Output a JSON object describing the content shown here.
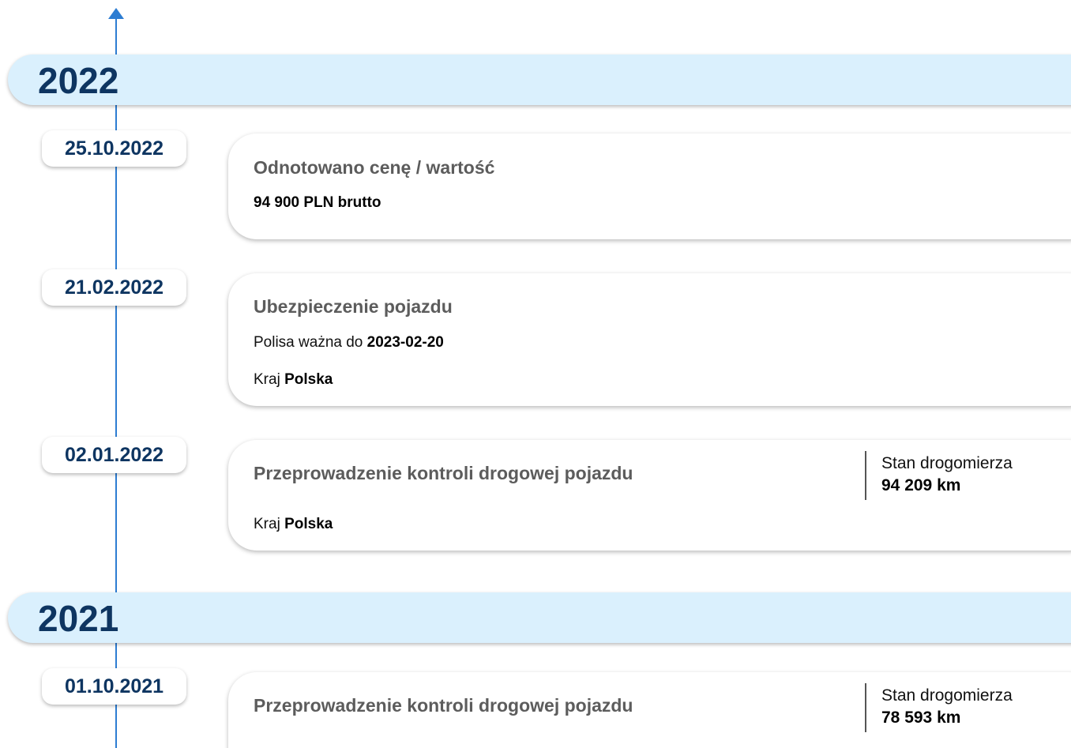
{
  "timeline": {
    "years": [
      {
        "year": "2022",
        "events": [
          {
            "date": "25.10.2022",
            "title": "Odnotowano cenę / wartość",
            "price": "94 900 PLN brutto"
          },
          {
            "date": "21.02.2022",
            "title": "Ubezpieczenie pojazdu",
            "policy_label": "Polisa ważna do",
            "policy_value": "2023-02-20",
            "country_label": "Kraj",
            "country_value": "Polska"
          },
          {
            "date": "02.01.2022",
            "title": "Przeprowadzenie kontroli drogowej pojazdu",
            "odometer_label": "Stan drogomierza",
            "odometer_value": "94 209 km",
            "country_label": "Kraj",
            "country_value": "Polska"
          }
        ]
      },
      {
        "year": "2021",
        "events": [
          {
            "date": "01.10.2021",
            "title": "Przeprowadzenie kontroli drogowej pojazdu",
            "odometer_label": "Stan drogomierza",
            "odometer_value": "78 593 km"
          }
        ]
      }
    ]
  },
  "colors": {
    "accent_line": "#2d7dd2",
    "year_banner_bg": "#daf0fd",
    "year_text": "#0e3561",
    "date_text": "#0e3561",
    "event_title": "#5c5c5c"
  },
  "icons": {
    "axis_arrow": "arrow-up-icon"
  }
}
